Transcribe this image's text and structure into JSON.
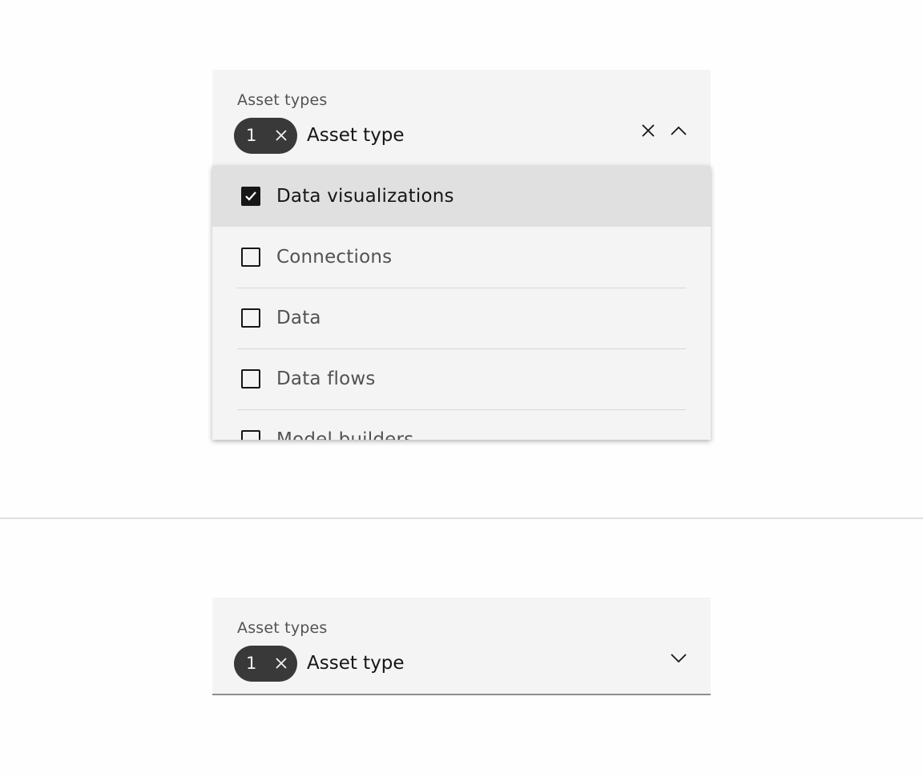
{
  "open_dropdown": {
    "label": "Asset types",
    "selected_count": "1",
    "placeholder": "Asset type",
    "icons": {
      "clear": "close-icon",
      "toggle": "chevron-up-icon",
      "tag_clear": "close-icon"
    },
    "items": [
      {
        "label": "Data visualizations",
        "checked": true
      },
      {
        "label": "Connections",
        "checked": false
      },
      {
        "label": "Data",
        "checked": false
      },
      {
        "label": "Data flows",
        "checked": false
      },
      {
        "label": "Model builders",
        "checked": false
      }
    ]
  },
  "closed_dropdown": {
    "label": "Asset types",
    "selected_count": "1",
    "placeholder": "Asset type",
    "icons": {
      "toggle": "chevron-down-icon",
      "tag_clear": "close-icon"
    }
  },
  "colors": {
    "field_bg": "#f4f4f4",
    "tag_bg": "#393939",
    "selected_item_bg": "#e0e0e0",
    "text_primary": "#161616",
    "text_secondary": "#525252"
  }
}
